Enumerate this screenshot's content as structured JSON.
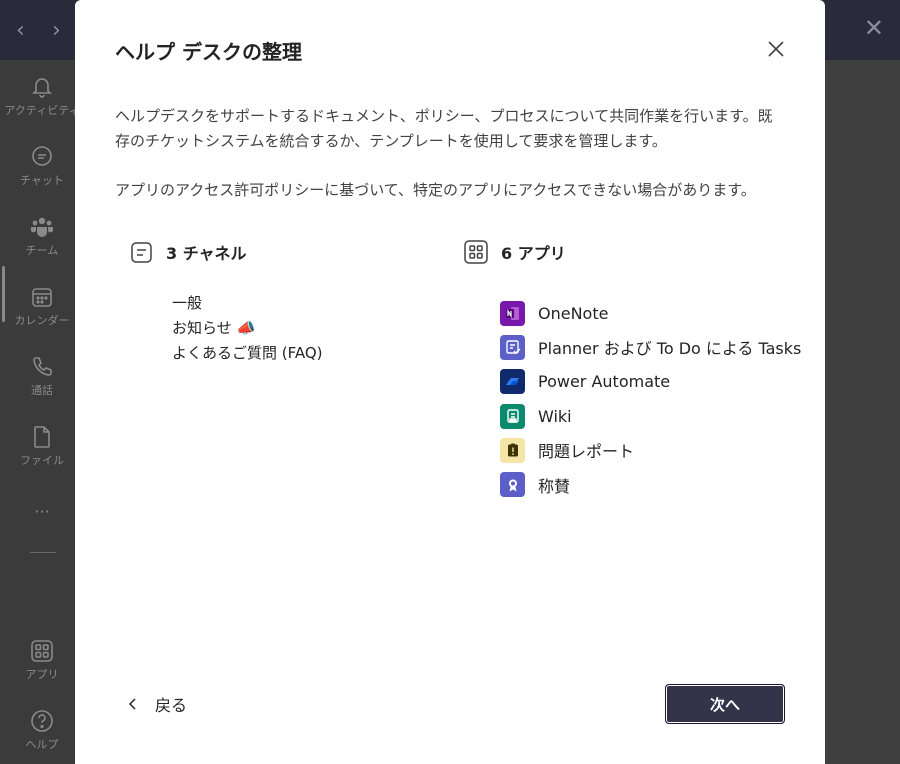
{
  "background": {
    "rail": [
      {
        "label": "アクティビティ",
        "icon": "bell-icon"
      },
      {
        "label": "チャット",
        "icon": "chat-icon"
      },
      {
        "label": "チーム",
        "icon": "teams-icon"
      },
      {
        "label": "カレンダー",
        "icon": "calendar-icon"
      },
      {
        "label": "通話",
        "icon": "phone-icon"
      },
      {
        "label": "ファイル",
        "icon": "file-icon"
      },
      {
        "label": "···",
        "icon": "more-icon"
      },
      {
        "label": "アプリ",
        "icon": "apps-icon"
      },
      {
        "label": "ヘルプ",
        "icon": "help-icon"
      }
    ]
  },
  "dialog": {
    "title": "ヘルプ デスクの整理",
    "description": "ヘルプデスクをサポートするドキュメント、ポリシー、プロセスについて共同作業を行います。既存のチケットシステムを統合するか、テンプレートを使用して要求を管理します。",
    "note": "アプリのアクセス許可ポリシーに基づいて、特定のアプリにアクセスできない場合があります。",
    "channels": {
      "heading": "3 チャネル",
      "items": [
        "一般",
        "お知らせ 📣",
        "よくあるご質問 (FAQ)"
      ]
    },
    "apps": {
      "heading": "6 アプリ",
      "items": [
        {
          "name": "OneNote",
          "icon": "onenote-icon",
          "color": "#7719aa"
        },
        {
          "name": "Planner および To Do による Tasks",
          "icon": "tasks-icon",
          "color": "#5b5fc7"
        },
        {
          "name": "Power Automate",
          "icon": "power-automate-icon",
          "color": "#0f2b6b"
        },
        {
          "name": "Wiki",
          "icon": "wiki-icon",
          "color": "#0b8a6e"
        },
        {
          "name": "問題レポート",
          "icon": "issue-report-icon",
          "color": "#f5e6a8"
        },
        {
          "name": "称賛",
          "icon": "praise-icon",
          "color": "#5b5fc7"
        }
      ]
    },
    "back_label": "戻る",
    "next_label": "次へ"
  }
}
